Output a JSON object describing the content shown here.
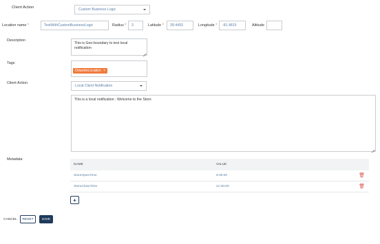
{
  "client_action_top": {
    "label": "Client Action",
    "value": "Custom Business Logic"
  },
  "location": {
    "name_label": "Location name",
    "name_value": "TestWithCustomBusinessLogic",
    "radius_label": "Radius",
    "radius_value": "3",
    "latitude_label": "Latitude",
    "latitude_value": "28.4493",
    "longitude_label": "Longitude",
    "longitude_value": "-81.4815",
    "altitude_label": "Altitude",
    "altitude_value": "",
    "required_mark": "*"
  },
  "description": {
    "label": "Description",
    "value": "This is Geo-boundary to test local notification"
  },
  "tags": {
    "label": "Tags",
    "items": [
      {
        "text": "OrlandoLocation",
        "remove": "×"
      }
    ]
  },
  "client_action": {
    "label": "Client Action",
    "value": "Local Client Notification"
  },
  "notification": {
    "value": "This is a local notification : Welcome to the Store"
  },
  "metadata": {
    "label": "Metadata",
    "col_name": "NAME",
    "col_value": "VALUE",
    "rows": [
      {
        "name": "StoreOpenTime",
        "value": "9:30:00"
      },
      {
        "name": "StoreCloseTime",
        "value": "21:30:00"
      }
    ],
    "add_label": "+"
  },
  "actions": {
    "cancel": "CANCEL",
    "reset": "RESET",
    "save": "SAVE"
  },
  "colors": {
    "accent": "#1f3b5c",
    "tag": "#f07a3c",
    "danger": "#d9534f"
  }
}
